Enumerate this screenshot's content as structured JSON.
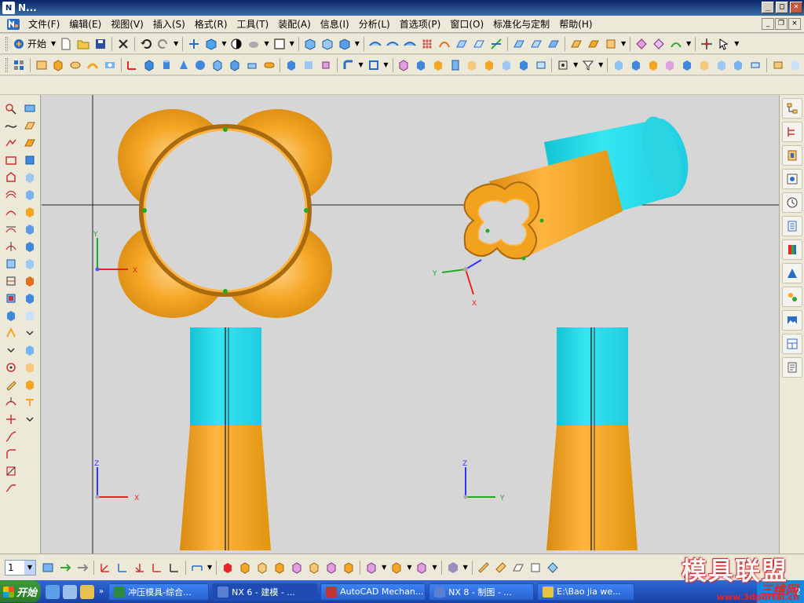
{
  "window": {
    "title": "N...",
    "app_icon": "nx-icon"
  },
  "menu": [
    "文件(F)",
    "编辑(E)",
    "视图(V)",
    "插入(S)",
    "格式(R)",
    "工具(T)",
    "装配(A)",
    "信息(I)",
    "分析(L)",
    "首选项(P)",
    "窗口(O)",
    "标准化与定制",
    "帮助(H)"
  ],
  "toolbar": {
    "start_label": "开始"
  },
  "layer": {
    "value": "1"
  },
  "triads": [
    {
      "a": "Y",
      "b": "X"
    },
    {
      "a": "Y",
      "b": "X"
    },
    {
      "a": "Z",
      "b": "X"
    },
    {
      "a": "Z",
      "b": "Y"
    }
  ],
  "taskbar": {
    "start": "开始",
    "items": [
      {
        "label": "冲压模具-综合...",
        "icon_color": "#2c8a3c",
        "active": false
      },
      {
        "label": "NX 6 - 建模 - ...",
        "icon_color": "#5a7fd0",
        "active": true
      },
      {
        "label": "AutoCAD Mechan...",
        "icon_color": "#c8342c",
        "active": false
      },
      {
        "label": "NX 8 - 制图 - ...",
        "icon_color": "#5a7fd0",
        "active": false
      },
      {
        "label": "E:\\Bao jia we...",
        "icon_color": "#e7c341",
        "active": false
      }
    ],
    "tray": "2"
  },
  "watermark": {
    "title": "模具联盟",
    "site": "三维网",
    "url": "www.3dportal.cn"
  },
  "colors": {
    "orange": "#f5a623",
    "cyan": "#22d8e6",
    "viewport": "#d6d6d6"
  }
}
